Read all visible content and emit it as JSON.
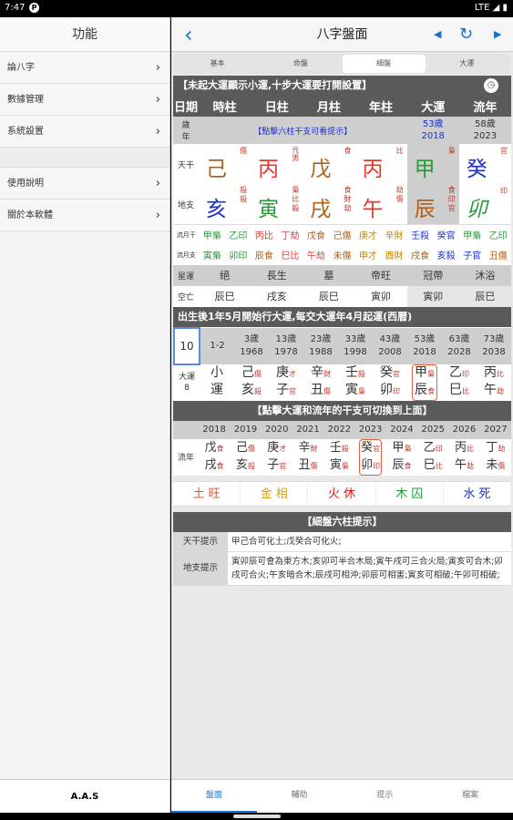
{
  "status": {
    "time": "7:47",
    "signal": "LTE ◢ ▮"
  },
  "sidebar": {
    "title": "功能",
    "items": [
      {
        "label": "論八字"
      },
      {
        "label": "數據管理"
      },
      {
        "label": "系統設置"
      },
      {
        "label": "使用說明"
      },
      {
        "label": "關於本軟體"
      }
    ],
    "footer": "A.A.S"
  },
  "nav": {
    "title": "八字盤面",
    "back": "‹",
    "prev": "◀",
    "refresh": "↻",
    "next": "▶"
  },
  "segments": [
    "基本",
    "命盤",
    "細盤",
    "大運"
  ],
  "banner1": "【未起大運顯示小運,十步大運要打開設置】",
  "cols": [
    "日期",
    "時柱",
    "日柱",
    "月柱",
    "年柱",
    "大運",
    "流年"
  ],
  "row_age": {
    "label": "歲\n年",
    "hint": "【點擊六柱干支可看提示】",
    "dy_age": "53歲",
    "dy_year": "2018",
    "ln_age": "58歲",
    "ln_year": "2023"
  },
  "tiangan": {
    "label": "天干",
    "chars": [
      "己",
      "丙",
      "戊",
      "丙",
      "甲",
      "癸"
    ],
    "ss": [
      "傷",
      "元男",
      "食",
      "比",
      "梟",
      "官"
    ]
  },
  "dizhi": {
    "label": "地支",
    "chars": [
      "亥",
      "寅",
      "戌",
      "午",
      "辰",
      "卯"
    ],
    "ss": [
      "殺\n殺",
      "梟\n比\n殺",
      "食\n財\n劫",
      "劫\n傷",
      "食\n印\n官",
      "印"
    ]
  },
  "cangan": {
    "gan": [
      "流月干",
      "甲梟",
      "乙印",
      "丙比",
      "丁劫",
      "戊食",
      "己傷",
      "庚才",
      "辛財",
      "壬殺",
      "癸官",
      "甲梟",
      "乙印"
    ],
    "zhi": [
      "流月支",
      "寅梟",
      "卯印",
      "辰食",
      "巳比",
      "午劫",
      "未傷",
      "申才",
      "酉財",
      "戌食",
      "亥殺",
      "子官",
      "丑傷"
    ]
  },
  "xingyun": {
    "label": "星運",
    "vals": [
      "絕",
      "長生",
      "墓",
      "帝旺",
      "冠帶",
      "沐浴"
    ]
  },
  "kongwang": {
    "label": "空亡",
    "vals": [
      "辰巳",
      "戌亥",
      "辰巳",
      "寅卯",
      "寅卯",
      "辰巳"
    ]
  },
  "banner2": "出生後1年5月開始行大運,每交大運年4月起運(西曆)",
  "dayun": {
    "first": "10",
    "xy": "1-2",
    "ages": [
      "3歲",
      "13歲",
      "23歲",
      "33歲",
      "43歲",
      "53歲",
      "63歲",
      "73歲"
    ],
    "years": [
      "1968",
      "1978",
      "1988",
      "1998",
      "2008",
      "2018",
      "2028",
      "2038"
    ],
    "label": "大運\n8",
    "gan": [
      "小",
      "己",
      "庚",
      "辛",
      "壬",
      "癸",
      "甲",
      "乙",
      "丙"
    ],
    "zhi": [
      "運",
      "亥",
      "子",
      "丑",
      "寅",
      "卯",
      "辰",
      "巳",
      "午"
    ],
    "gss": [
      "",
      "傷",
      "才",
      "財",
      "殺",
      "官",
      "梟",
      "印",
      "比"
    ],
    "zss": [
      "",
      "殺",
      "官",
      "傷",
      "梟",
      "印",
      "食",
      "比",
      "劫"
    ]
  },
  "banner3": "【點擊大運和流年的干支可切換到上面】",
  "liunian": {
    "label": "流年",
    "years": [
      "2018",
      "2019",
      "2020",
      "2021",
      "2022",
      "2023",
      "2024",
      "2025",
      "2026",
      "2027"
    ],
    "gan": [
      "戊",
      "己",
      "庚",
      "辛",
      "壬",
      "癸",
      "甲",
      "乙",
      "丙",
      "丁"
    ],
    "zhi": [
      "戌",
      "亥",
      "子",
      "丑",
      "寅",
      "卯",
      "辰",
      "巳",
      "午",
      "未"
    ],
    "gss": [
      "食",
      "傷",
      "才",
      "財",
      "殺",
      "官",
      "梟",
      "印",
      "比",
      "劫"
    ],
    "zss": [
      "食",
      "殺",
      "官",
      "傷",
      "梟",
      "印",
      "食",
      "比",
      "劫",
      "傷"
    ]
  },
  "wuxing": [
    {
      "e": "土",
      "s": "旺"
    },
    {
      "e": "金",
      "s": "相"
    },
    {
      "e": "火",
      "s": "休"
    },
    {
      "e": "木",
      "s": "囚"
    },
    {
      "e": "水",
      "s": "死"
    }
  ],
  "banner4": "【細盤六柱提示】",
  "tips": {
    "tg_label": "天干提示",
    "tg": "甲己合可化土;戊癸合可化火;",
    "dz_label": "地支提示",
    "dz": "寅卯辰可會為東方木;亥卯可半合木局;寅午戌可三合火局;寅亥可合木;卯戌可合火;午亥暗合木;辰戌可相沖;卯辰可相害;寅亥可相破;午卯可相破;"
  },
  "tabs": [
    "盤面",
    "輔助",
    "提示",
    "檔案"
  ]
}
